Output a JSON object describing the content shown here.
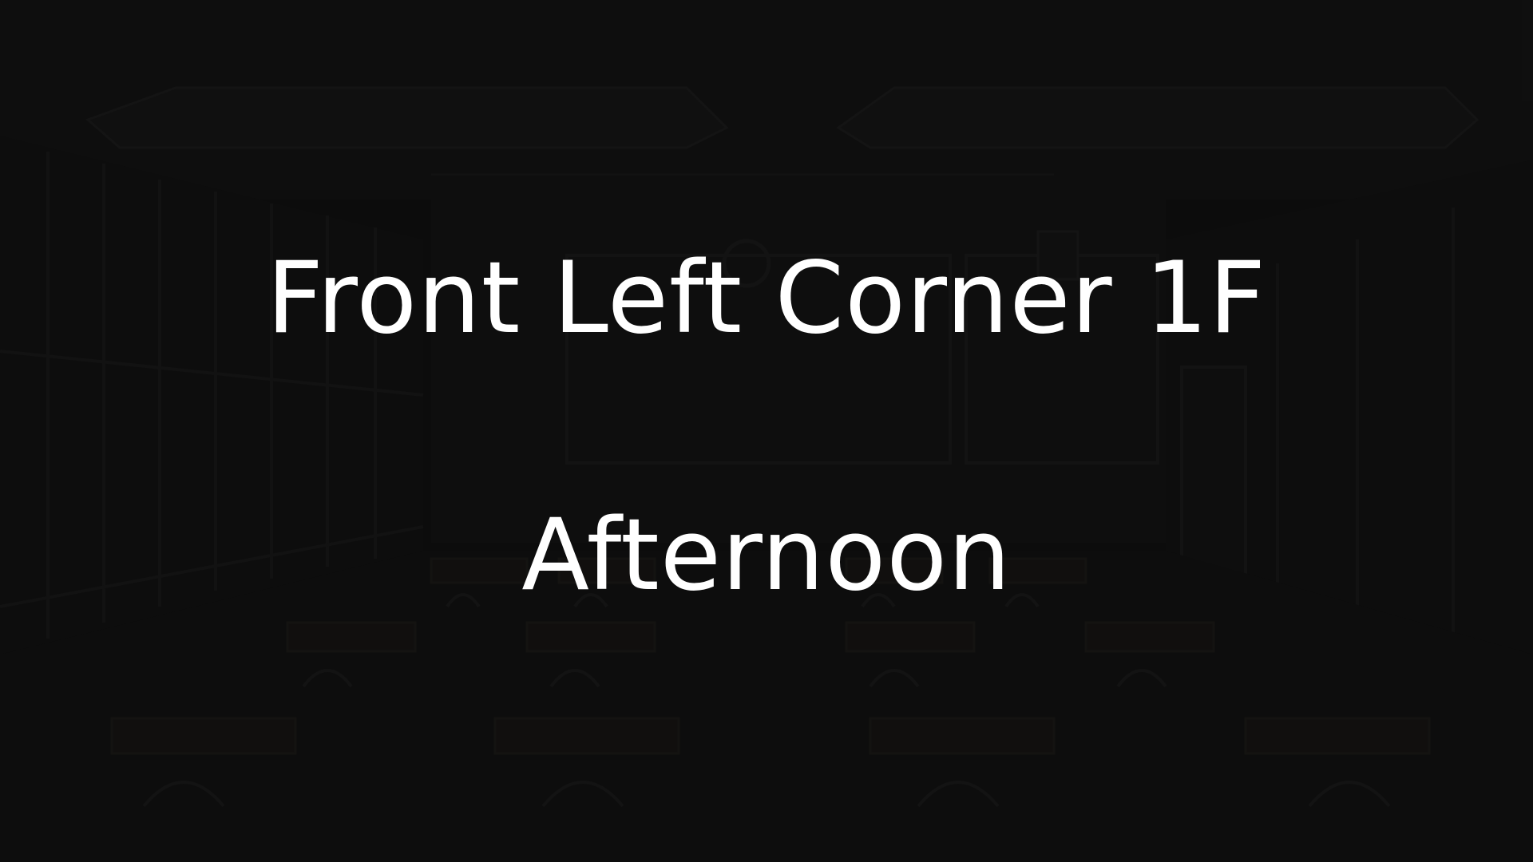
{
  "scene": {
    "location_text": "Front Left Corner 1F",
    "time_text": "Afternoon",
    "text_color": "#ffffff",
    "background_color": "#101010",
    "background_description_icon": "classroom-background"
  }
}
